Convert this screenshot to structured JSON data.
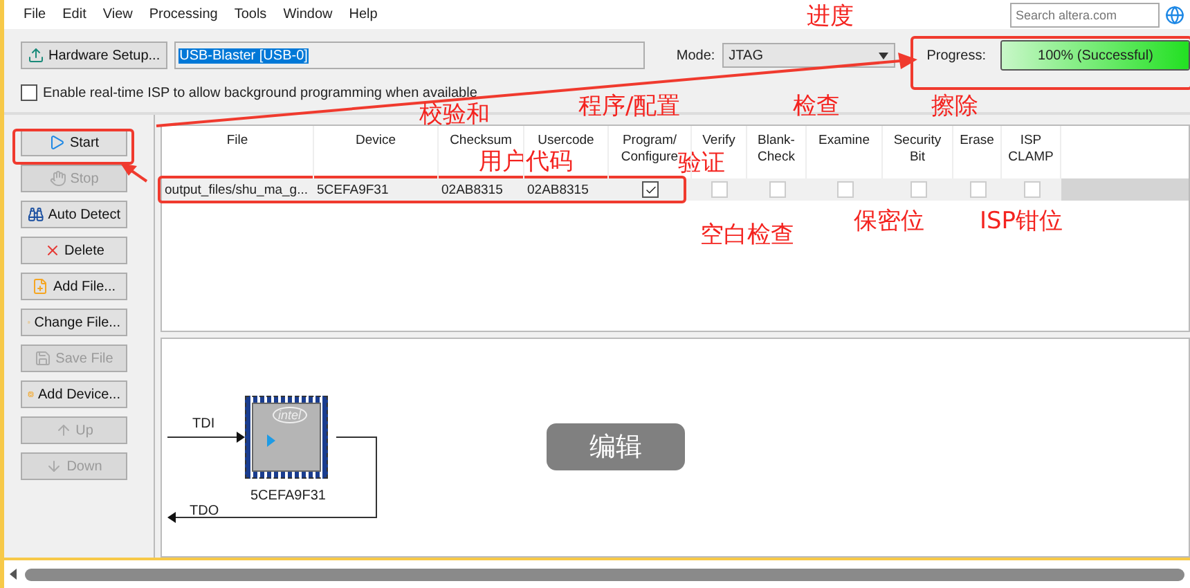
{
  "menu": [
    "File",
    "Edit",
    "View",
    "Processing",
    "Tools",
    "Window",
    "Help"
  ],
  "search": {
    "placeholder": "Search altera.com"
  },
  "hardware": {
    "button": "Hardware Setup...",
    "value": "USB-Blaster [USB-0]",
    "mode_label": "Mode:",
    "mode_value": "JTAG",
    "progress_label": "Progress:",
    "progress_text": "100% (Successful)",
    "level": 1
  },
  "realtime_isp": {
    "label": "Enable real-time ISP to allow background programming when available",
    "checked": false
  },
  "actions": [
    {
      "label": "Start",
      "disabled": false
    },
    {
      "label": "Stop",
      "disabled": true
    },
    {
      "label": "Auto Detect",
      "disabled": false
    },
    {
      "label": "Delete",
      "disabled": false
    },
    {
      "label": "Add File...",
      "disabled": false
    },
    {
      "label": "Change File...",
      "disabled": false
    },
    {
      "label": "Save File",
      "disabled": true
    },
    {
      "label": "Add Device...",
      "disabled": false
    },
    {
      "label": "Up",
      "disabled": true
    },
    {
      "label": "Down",
      "disabled": true
    }
  ],
  "table": {
    "columns": [
      "File",
      "Device",
      "Checksum",
      "Usercode",
      "Program/\nConfigure",
      "Verify",
      "Blank-\nCheck",
      "Examine",
      "Security\nBit",
      "Erase",
      "ISP\nCLAMP"
    ],
    "rows": [
      {
        "selected": true,
        "file": "output_files/shu_ma_g...",
        "device": "5CEFA9F31",
        "checksum": "02AB8315",
        "usercode": "02AB8315",
        "options": [
          true,
          false,
          false,
          false,
          false,
          false,
          false
        ]
      }
    ]
  },
  "chain": {
    "tdi": "TDI",
    "tdo": "TDO",
    "device": "5CEFA9F31",
    "chip_logo": "intel"
  },
  "edit_button": "编辑",
  "annotations": [
    "进度",
    "校验和",
    "程序/配置",
    "检查",
    "擦除",
    "用户代码",
    "验证",
    "空白检查",
    "保密位",
    "ISP钳位"
  ]
}
